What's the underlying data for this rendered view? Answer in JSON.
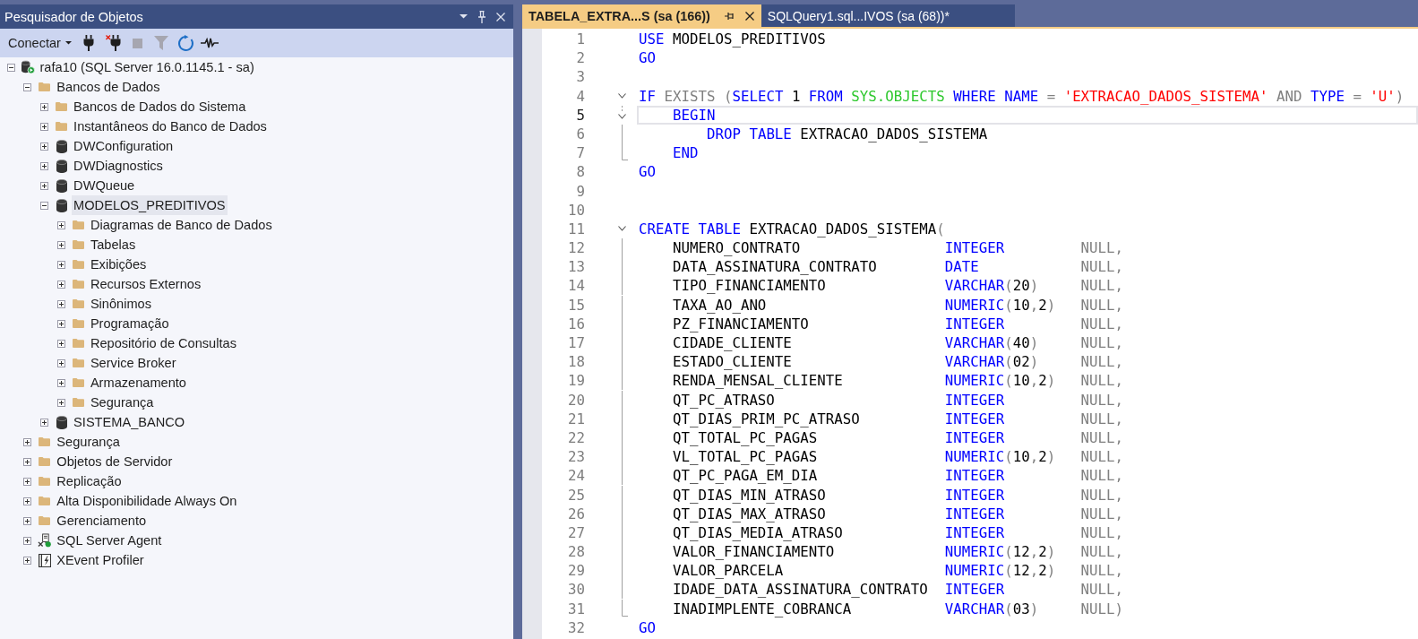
{
  "object_explorer": {
    "title": "Pesquisador de Objetos",
    "toolbar": {
      "connect_label": "Conectar",
      "tools": [
        {
          "disabled": false
        },
        {
          "disabled": false
        },
        {
          "disabled": true
        },
        {
          "disabled": true
        },
        {
          "disabled": false
        },
        {
          "disabled": false
        }
      ]
    },
    "tree": [
      {
        "label": "rafa10 (SQL Server 16.0.1145.1 - sa)",
        "kind": "server",
        "expanded": true,
        "selected": false,
        "children": [
          {
            "label": "Bancos de Dados",
            "kind": "folder",
            "expanded": true,
            "selected": false,
            "children": [
              {
                "label": "Bancos de Dados do Sistema",
                "kind": "folder",
                "expanded": false,
                "selected": false
              },
              {
                "label": "Instantâneos do Banco de Dados",
                "kind": "folder",
                "expanded": false,
                "selected": false
              },
              {
                "label": "DWConfiguration",
                "kind": "database",
                "expanded": false,
                "selected": false
              },
              {
                "label": "DWDiagnostics",
                "kind": "database",
                "expanded": false,
                "selected": false
              },
              {
                "label": "DWQueue",
                "kind": "database",
                "expanded": false,
                "selected": false
              },
              {
                "label": "MODELOS_PREDITIVOS",
                "kind": "database",
                "expanded": true,
                "selected": true,
                "children": [
                  {
                    "label": "Diagramas de Banco de Dados",
                    "kind": "folder",
                    "expanded": false,
                    "selected": false
                  },
                  {
                    "label": "Tabelas",
                    "kind": "folder",
                    "expanded": false,
                    "selected": false
                  },
                  {
                    "label": "Exibições",
                    "kind": "folder",
                    "expanded": false,
                    "selected": false
                  },
                  {
                    "label": "Recursos Externos",
                    "kind": "folder",
                    "expanded": false,
                    "selected": false
                  },
                  {
                    "label": "Sinônimos",
                    "kind": "folder",
                    "expanded": false,
                    "selected": false
                  },
                  {
                    "label": "Programação",
                    "kind": "folder",
                    "expanded": false,
                    "selected": false
                  },
                  {
                    "label": "Repositório de Consultas",
                    "kind": "folder",
                    "expanded": false,
                    "selected": false
                  },
                  {
                    "label": "Service Broker",
                    "kind": "folder",
                    "expanded": false,
                    "selected": false
                  },
                  {
                    "label": "Armazenamento",
                    "kind": "folder",
                    "expanded": false,
                    "selected": false
                  },
                  {
                    "label": "Segurança",
                    "kind": "folder",
                    "expanded": false,
                    "selected": false
                  }
                ]
              },
              {
                "label": "SISTEMA_BANCO",
                "kind": "database",
                "expanded": false,
                "selected": false
              }
            ]
          },
          {
            "label": "Segurança",
            "kind": "folder",
            "expanded": false,
            "selected": false
          },
          {
            "label": "Objetos de Servidor",
            "kind": "folder",
            "expanded": false,
            "selected": false
          },
          {
            "label": "Replicação",
            "kind": "folder",
            "expanded": false,
            "selected": false
          },
          {
            "label": "Alta Disponibilidade Always On",
            "kind": "folder",
            "expanded": false,
            "selected": false
          },
          {
            "label": "Gerenciamento",
            "kind": "folder",
            "expanded": false,
            "selected": false
          },
          {
            "label": "SQL Server Agent",
            "kind": "agent",
            "expanded": false,
            "selected": false
          },
          {
            "label": "XEvent Profiler",
            "kind": "profiler",
            "expanded": false,
            "selected": false
          }
        ]
      }
    ]
  },
  "editor": {
    "tabs": [
      {
        "label": "TABELA_EXTRA...S (sa (166))",
        "selected": true
      },
      {
        "label": "SQLQuery1.sql...IVOS (sa (68))*",
        "selected": false
      }
    ],
    "lines": [
      {
        "number": "1",
        "current": false,
        "kind": "code",
        "tokens": [
          {
            "kind": "keyword",
            "text": "USE"
          },
          {
            "kind": "identifier",
            "text": " MODELOS_PREDITIVOS"
          }
        ]
      },
      {
        "number": "2",
        "current": false,
        "kind": "code",
        "tokens": [
          {
            "kind": "keyword",
            "text": "GO"
          }
        ]
      },
      {
        "number": "3",
        "current": false,
        "kind": "code"
      },
      {
        "number": "4",
        "current": false,
        "kind": "code",
        "expanded": true,
        "tokens": [
          {
            "kind": "keyword",
            "text": "IF "
          },
          {
            "kind": "operator",
            "text": "EXISTS ("
          },
          {
            "kind": "keyword",
            "text": "SELECT "
          },
          {
            "kind": "identifier",
            "text": "1 "
          },
          {
            "kind": "keyword",
            "text": "FROM "
          },
          {
            "kind": "system",
            "text": "SYS.OBJECTS "
          },
          {
            "kind": "keyword",
            "text": "WHERE NAME "
          },
          {
            "kind": "operator",
            "text": "= "
          },
          {
            "kind": "string",
            "text": "'EXTRACAO_DADOS_SISTEMA' "
          },
          {
            "kind": "operator",
            "text": "AND "
          },
          {
            "kind": "keyword",
            "text": "TYPE "
          },
          {
            "kind": "operator",
            "text": "= "
          },
          {
            "kind": "string",
            "text": "'U'"
          },
          {
            "kind": "operator",
            "text": ")"
          }
        ],
        "children": [
          {
            "number": "5",
            "current": true,
            "kind": "code",
            "expanded": true,
            "tokens": [
              {
                "kind": "keyword",
                "text": "    BEGIN"
              }
            ],
            "children": [
              {
                "number": "6",
                "current": false,
                "kind": "code",
                "tokens": [
                  {
                    "kind": "keyword",
                    "text": "        DROP TABLE"
                  },
                  {
                    "kind": "identifier",
                    "text": " EXTRACAO_DADOS_SISTEMA"
                  }
                ]
              },
              {
                "number": "7",
                "current": false,
                "kind": "code",
                "tokens": [
                  {
                    "kind": "keyword",
                    "text": "    END"
                  }
                ]
              }
            ]
          }
        ]
      },
      {
        "number": "8",
        "current": false,
        "kind": "code",
        "tokens": [
          {
            "kind": "keyword",
            "text": "GO"
          }
        ]
      },
      {
        "number": "9",
        "current": false,
        "kind": "code"
      },
      {
        "number": "10",
        "current": false,
        "kind": "code"
      },
      {
        "number": "11",
        "current": false,
        "kind": "code",
        "expanded": true,
        "tokens": [
          {
            "kind": "keyword",
            "text": "CREATE TABLE"
          },
          {
            "kind": "identifier",
            "text": " EXTRACAO_DADOS_SISTEMA"
          },
          {
            "kind": "operator",
            "text": "("
          }
        ],
        "children": [
          {
            "number": "12",
            "current": false,
            "kind": "column",
            "name": "NUMERO_CONTRATO",
            "type": [
              {
                "kind": "keyword",
                "text": "INTEGER"
              }
            ],
            "nullability": [
              {
                "kind": "operator",
                "text": "NULL,"
              }
            ]
          },
          {
            "number": "13",
            "current": false,
            "kind": "column",
            "name": "DATA_ASSINATURA_CONTRATO",
            "type": [
              {
                "kind": "keyword",
                "text": "DATE"
              }
            ],
            "nullability": [
              {
                "kind": "operator",
                "text": "NULL,"
              }
            ]
          },
          {
            "number": "14",
            "current": false,
            "kind": "column",
            "name": "TIPO_FINANCIAMENTO",
            "type": [
              {
                "kind": "keyword",
                "text": "VARCHAR"
              },
              {
                "kind": "operator",
                "text": "("
              },
              {
                "kind": "identifier",
                "text": "20"
              },
              {
                "kind": "operator",
                "text": ")"
              }
            ],
            "nullability": [
              {
                "kind": "operator",
                "text": "NULL,"
              }
            ]
          },
          {
            "number": "15",
            "current": false,
            "kind": "column",
            "name": "TAXA_AO_ANO",
            "type": [
              {
                "kind": "keyword",
                "text": "NUMERIC"
              },
              {
                "kind": "operator",
                "text": "("
              },
              {
                "kind": "identifier",
                "text": "10"
              },
              {
                "kind": "operator",
                "text": ","
              },
              {
                "kind": "identifier",
                "text": "2"
              },
              {
                "kind": "operator",
                "text": ")"
              }
            ],
            "nullability": [
              {
                "kind": "operator",
                "text": "NULL,"
              }
            ]
          },
          {
            "number": "16",
            "current": false,
            "kind": "column",
            "name": "PZ_FINANCIAMENTO",
            "type": [
              {
                "kind": "keyword",
                "text": "INTEGER"
              }
            ],
            "nullability": [
              {
                "kind": "operator",
                "text": "NULL,"
              }
            ]
          },
          {
            "number": "17",
            "current": false,
            "kind": "column",
            "name": "CIDADE_CLIENTE",
            "type": [
              {
                "kind": "keyword",
                "text": "VARCHAR"
              },
              {
                "kind": "operator",
                "text": "("
              },
              {
                "kind": "identifier",
                "text": "40"
              },
              {
                "kind": "operator",
                "text": ")"
              }
            ],
            "nullability": [
              {
                "kind": "operator",
                "text": "NULL,"
              }
            ]
          },
          {
            "number": "18",
            "current": false,
            "kind": "column",
            "name": "ESTADO_CLIENTE",
            "type": [
              {
                "kind": "keyword",
                "text": "VARCHAR"
              },
              {
                "kind": "operator",
                "text": "("
              },
              {
                "kind": "identifier",
                "text": "02"
              },
              {
                "kind": "operator",
                "text": ")"
              }
            ],
            "nullability": [
              {
                "kind": "operator",
                "text": "NULL,"
              }
            ]
          },
          {
            "number": "19",
            "current": false,
            "kind": "column",
            "name": "RENDA_MENSAL_CLIENTE",
            "type": [
              {
                "kind": "keyword",
                "text": "NUMERIC"
              },
              {
                "kind": "operator",
                "text": "("
              },
              {
                "kind": "identifier",
                "text": "10"
              },
              {
                "kind": "operator",
                "text": ","
              },
              {
                "kind": "identifier",
                "text": "2"
              },
              {
                "kind": "operator",
                "text": ")"
              }
            ],
            "nullability": [
              {
                "kind": "operator",
                "text": "NULL,"
              }
            ]
          },
          {
            "number": "20",
            "current": false,
            "kind": "column",
            "name": "QT_PC_ATRASO",
            "type": [
              {
                "kind": "keyword",
                "text": "INTEGER"
              }
            ],
            "nullability": [
              {
                "kind": "operator",
                "text": "NULL,"
              }
            ]
          },
          {
            "number": "21",
            "current": false,
            "kind": "column",
            "name": "QT_DIAS_PRIM_PC_ATRASO",
            "type": [
              {
                "kind": "keyword",
                "text": "INTEGER"
              }
            ],
            "nullability": [
              {
                "kind": "operator",
                "text": "NULL,"
              }
            ]
          },
          {
            "number": "22",
            "current": false,
            "kind": "column",
            "name": "QT_TOTAL_PC_PAGAS",
            "type": [
              {
                "kind": "keyword",
                "text": "INTEGER"
              }
            ],
            "nullability": [
              {
                "kind": "operator",
                "text": "NULL,"
              }
            ]
          },
          {
            "number": "23",
            "current": false,
            "kind": "column",
            "name": "VL_TOTAL_PC_PAGAS",
            "type": [
              {
                "kind": "keyword",
                "text": "NUMERIC"
              },
              {
                "kind": "operator",
                "text": "("
              },
              {
                "kind": "identifier",
                "text": "10"
              },
              {
                "kind": "operator",
                "text": ","
              },
              {
                "kind": "identifier",
                "text": "2"
              },
              {
                "kind": "operator",
                "text": ")"
              }
            ],
            "nullability": [
              {
                "kind": "operator",
                "text": "NULL,"
              }
            ]
          },
          {
            "number": "24",
            "current": false,
            "kind": "column",
            "name": "QT_PC_PAGA_EM_DIA",
            "type": [
              {
                "kind": "keyword",
                "text": "INTEGER"
              }
            ],
            "nullability": [
              {
                "kind": "operator",
                "text": "NULL,"
              }
            ]
          },
          {
            "number": "25",
            "current": false,
            "kind": "column",
            "name": "QT_DIAS_MIN_ATRASO",
            "type": [
              {
                "kind": "keyword",
                "text": "INTEGER"
              }
            ],
            "nullability": [
              {
                "kind": "operator",
                "text": "NULL,"
              }
            ]
          },
          {
            "number": "26",
            "current": false,
            "kind": "column",
            "name": "QT_DIAS_MAX_ATRASO",
            "type": [
              {
                "kind": "keyword",
                "text": "INTEGER"
              }
            ],
            "nullability": [
              {
                "kind": "operator",
                "text": "NULL,"
              }
            ]
          },
          {
            "number": "27",
            "current": false,
            "kind": "column",
            "name": "QT_DIAS_MEDIA_ATRASO",
            "type": [
              {
                "kind": "keyword",
                "text": "INTEGER"
              }
            ],
            "nullability": [
              {
                "kind": "operator",
                "text": "NULL,"
              }
            ]
          },
          {
            "number": "28",
            "current": false,
            "kind": "column",
            "name": "VALOR_FINANCIAMENTO",
            "type": [
              {
                "kind": "keyword",
                "text": "NUMERIC"
              },
              {
                "kind": "operator",
                "text": "("
              },
              {
                "kind": "identifier",
                "text": "12"
              },
              {
                "kind": "operator",
                "text": ","
              },
              {
                "kind": "identifier",
                "text": "2"
              },
              {
                "kind": "operator",
                "text": ")"
              }
            ],
            "nullability": [
              {
                "kind": "operator",
                "text": "NULL,"
              }
            ]
          },
          {
            "number": "29",
            "current": false,
            "kind": "column",
            "name": "VALOR_PARCELA",
            "type": [
              {
                "kind": "keyword",
                "text": "NUMERIC"
              },
              {
                "kind": "operator",
                "text": "("
              },
              {
                "kind": "identifier",
                "text": "12"
              },
              {
                "kind": "operator",
                "text": ","
              },
              {
                "kind": "identifier",
                "text": "2"
              },
              {
                "kind": "operator",
                "text": ")"
              }
            ],
            "nullability": [
              {
                "kind": "operator",
                "text": "NULL,"
              }
            ]
          },
          {
            "number": "30",
            "current": false,
            "kind": "column",
            "name": "IDADE_DATA_ASSINATURA_CONTRATO",
            "type": [
              {
                "kind": "keyword",
                "text": "INTEGER"
              }
            ],
            "nullability": [
              {
                "kind": "operator",
                "text": "NULL,"
              }
            ]
          },
          {
            "number": "31",
            "current": false,
            "kind": "column",
            "name": "INADIMPLENTE_COBRANCA",
            "type": [
              {
                "kind": "keyword",
                "text": "VARCHAR"
              },
              {
                "kind": "operator",
                "text": "("
              },
              {
                "kind": "identifier",
                "text": "03"
              },
              {
                "kind": "operator",
                "text": ")"
              }
            ],
            "nullability": [
              {
                "kind": "operator",
                "text": "NULL)"
              }
            ]
          }
        ]
      },
      {
        "number": "32",
        "current": false,
        "kind": "code",
        "tokens": [
          {
            "kind": "keyword",
            "text": "GO"
          }
        ]
      }
    ]
  }
}
